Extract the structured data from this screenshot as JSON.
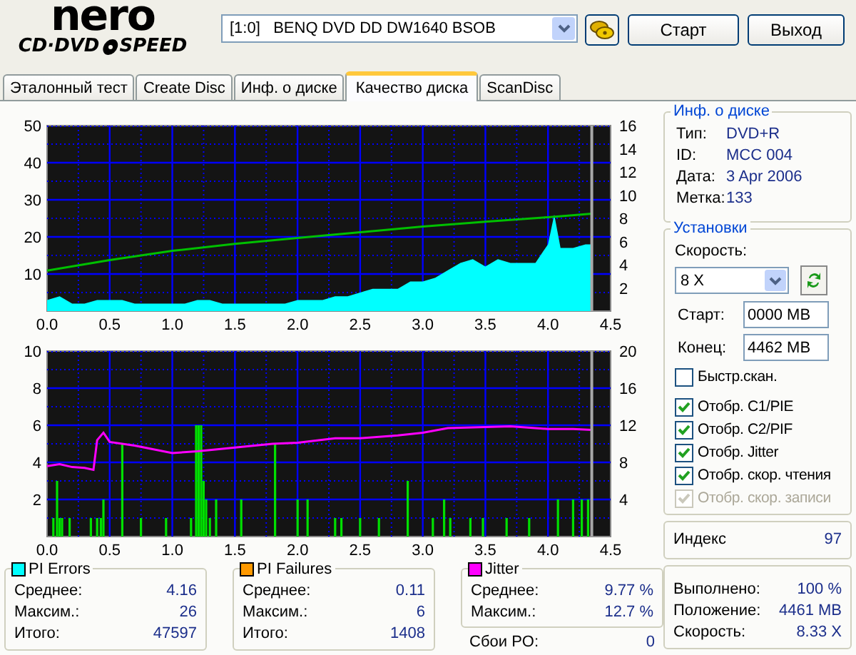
{
  "logo": {
    "brand": "nero",
    "product_left": "CD·DVD",
    "product_right": "SPEED"
  },
  "drive": {
    "value": "[1:0]   BENQ DVD DD DW1640 BSOB"
  },
  "buttons": [
    {
      "label": "Старт"
    },
    {
      "label": "Выход"
    }
  ],
  "tabs": [
    {
      "label": "Эталонный тест",
      "selected": false
    },
    {
      "label": "Create Disc",
      "selected": false
    },
    {
      "label": "Инф. о диске",
      "selected": false
    },
    {
      "label": "Качество диска",
      "selected": true
    },
    {
      "label": "ScanDisc",
      "selected": false
    }
  ],
  "charts": [
    {
      "layers": [
        {
          "chart_data": {
            "type": "area",
            "xlim": [
              0,
              4.5
            ],
            "ylim": [
              0,
              50
            ],
            "xticks": [
              {
                "value": 0,
                "label": "0.0"
              },
              {
                "value": 0.5,
                "label": "0.5"
              },
              {
                "value": 1,
                "label": "1.0"
              },
              {
                "value": 1.5,
                "label": "1.5"
              },
              {
                "value": 2,
                "label": "2.0"
              },
              {
                "value": 2.5,
                "label": "2.5"
              },
              {
                "value": 3,
                "label": "3.0"
              },
              {
                "value": 3.5,
                "label": "3.5"
              },
              {
                "value": 4,
                "label": "4.0"
              },
              {
                "value": 4.5,
                "label": "4.5"
              }
            ],
            "yticks": [
              10,
              20,
              30,
              40,
              50
            ],
            "x": [
              0,
              0.1,
              0.2,
              0.3,
              0.4,
              0.5,
              0.6,
              0.7,
              0.8,
              0.9,
              1,
              1.1,
              1.2,
              1.3,
              1.4,
              1.5,
              1.6,
              1.7,
              1.8,
              1.9,
              2,
              2.1,
              2.2,
              2.3,
              2.4,
              2.5,
              2.6,
              2.7,
              2.8,
              2.9,
              3,
              3.1,
              3.2,
              3.3,
              3.4,
              3.5,
              3.6,
              3.7,
              3.8,
              3.9,
              4,
              4.05,
              4.1,
              4.2,
              4.3,
              4.35
            ],
            "series": [
              {
                "color": "#00ffff",
                "values": [
                  3,
                  4,
                  2,
                  2,
                  3,
                  3,
                  3,
                  2,
                  2,
                  2,
                  2,
                  2,
                  3,
                  3,
                  2,
                  2,
                  2,
                  2,
                  2,
                  2,
                  3,
                  3,
                  3,
                  4,
                  4,
                  5,
                  6,
                  6,
                  6,
                  8,
                  8,
                  9,
                  11,
                  13,
                  14,
                  12,
                  14,
                  13,
                  13,
                  13,
                  18,
                  26,
                  17,
                  17,
                  18,
                  18
                ]
              }
            ]
          }
        },
        {
          "chart_data": {
            "type": "line",
            "xlim": [
              0,
              4.5
            ],
            "ylim": [
              0,
              16
            ],
            "yticks": [
              2,
              4,
              6,
              8,
              10,
              12,
              14,
              16
            ],
            "x": [
              0,
              0.5,
              1,
              1.5,
              2,
              2.5,
              3,
              3.5,
              4,
              4.35
            ],
            "series": [
              {
                "color": "#00c000",
                "values": [
                  3.5,
                  4.4,
                  5.2,
                  5.8,
                  6.3,
                  6.8,
                  7.3,
                  7.7,
                  8.1,
                  8.4
                ]
              }
            ]
          }
        }
      ]
    },
    {
      "layers": [
        {
          "chart_data": {
            "type": "bar",
            "xlim": [
              0,
              4.5
            ],
            "ylim": [
              0,
              10
            ],
            "xticks": [
              {
                "value": 0,
                "label": "0.0"
              },
              {
                "value": 0.5,
                "label": "0.5"
              },
              {
                "value": 1,
                "label": "1.0"
              },
              {
                "value": 1.5,
                "label": "1.5"
              },
              {
                "value": 2,
                "label": "2.0"
              },
              {
                "value": 2.5,
                "label": "2.5"
              },
              {
                "value": 3,
                "label": "3.0"
              },
              {
                "value": 3.5,
                "label": "3.5"
              },
              {
                "value": 4,
                "label": "4.0"
              },
              {
                "value": 4.5,
                "label": "4.5"
              }
            ],
            "yticks": [
              2,
              4,
              6,
              8,
              10
            ],
            "x": [
              0.05,
              0.08,
              0.1,
              0.12,
              0.18,
              0.35,
              0.4,
              0.43,
              0.45,
              0.6,
              0.75,
              0.95,
              1.15,
              1.19,
              1.21,
              1.23,
              1.25,
              1.27,
              1.3,
              1.35,
              1.55,
              1.82,
              2.0,
              2.08,
              2.3,
              2.35,
              2.5,
              2.65,
              2.88,
              3.08,
              3.17,
              3.22,
              3.38,
              3.48,
              3.67,
              3.85,
              4.08,
              4.2,
              4.27,
              4.32
            ],
            "series": [
              {
                "color": "#00e000",
                "values": [
                  1,
                  3,
                  1,
                  1,
                  1,
                  1,
                  1,
                  1,
                  2,
                  5,
                  1,
                  1,
                  1,
                  6,
                  6,
                  6,
                  3,
                  2,
                  1,
                  2,
                  2,
                  5,
                  2,
                  2,
                  1,
                  1,
                  1,
                  1,
                  3,
                  1,
                  2,
                  1,
                  1,
                  1,
                  1,
                  1,
                  2,
                  2,
                  2,
                  2
                ]
              }
            ]
          }
        },
        {
          "chart_data": {
            "type": "line",
            "xlim": [
              0,
              4.5
            ],
            "ylim": [
              0,
              20
            ],
            "yticks": [
              4,
              8,
              12,
              16,
              20
            ],
            "x": [
              0,
              0.1,
              0.2,
              0.3,
              0.37,
              0.4,
              0.45,
              0.5,
              0.7,
              1.0,
              1.2,
              1.5,
              1.8,
              2.0,
              2.3,
              2.5,
              2.8,
              3.0,
              3.2,
              3.5,
              3.7,
              4.0,
              4.2,
              4.35
            ],
            "series": [
              {
                "color": "#ff00ff",
                "values": [
                  7.6,
                  7.8,
                  7.5,
                  7.4,
                  7.2,
                  10.4,
                  11.2,
                  10.2,
                  9.8,
                  9.0,
                  9.2,
                  9.6,
                  10.0,
                  10.1,
                  10.6,
                  10.6,
                  10.9,
                  11.2,
                  11.7,
                  11.8,
                  11.9,
                  11.6,
                  11.6,
                  11.5
                ]
              }
            ]
          }
        }
      ]
    }
  ],
  "disc_info": {
    "title": "Инф. о диске",
    "rows": [
      {
        "label": "Тип:",
        "value": "DVD+R"
      },
      {
        "label": "ID:",
        "value": "MCC 004"
      },
      {
        "label": "Дата:",
        "value": "3 Apr 2006"
      },
      {
        "label": "Метка:",
        "value": "133"
      }
    ]
  },
  "settings": {
    "title": "Установки",
    "speed_label": "Скорость:",
    "speed": "8 X",
    "start_label": "Старт:",
    "start": "0000 MB",
    "end_label": "Конец:",
    "end": "4462 MB",
    "options": [
      {
        "label": "Быстр.скан.",
        "checked": false,
        "disabled": false
      },
      {
        "label": "Отобр. C1/PIE",
        "checked": true,
        "disabled": false
      },
      {
        "label": "Отобр. C2/PIF",
        "checked": true,
        "disabled": false
      },
      {
        "label": "Отобр. Jitter",
        "checked": true,
        "disabled": false
      },
      {
        "label": "Отобр. скор. чтения",
        "checked": true,
        "disabled": false
      },
      {
        "label": "Отобр. скор. записи",
        "checked": true,
        "disabled": true
      }
    ]
  },
  "index": {
    "label": "Индекс",
    "value": "97"
  },
  "progress": [
    {
      "label": "Выполнено:",
      "value": "100 %"
    },
    {
      "label": "Положение:",
      "value": "4461 MB"
    },
    {
      "label": "Скорость:",
      "value": "8.33 X"
    }
  ],
  "stats": [
    {
      "title": "PI Errors",
      "color": "#00ffff",
      "rows": [
        {
          "label": "Среднее:",
          "value": "4.16"
        },
        {
          "label": "Максим.:",
          "value": "26"
        },
        {
          "label": "Итого:",
          "value": "47597"
        }
      ]
    },
    {
      "title": "PI Failures",
      "color": "#ff9900",
      "rows": [
        {
          "label": "Среднее:",
          "value": "0.11"
        },
        {
          "label": "Максим.:",
          "value": "6"
        },
        {
          "label": "Итого:",
          "value": "1408"
        }
      ]
    },
    {
      "title": "Jitter",
      "color": "#ff00ff",
      "rows": [
        {
          "label": "Среднее:",
          "value": "9.77 %"
        },
        {
          "label": "Максим.:",
          "value": "12.7 %"
        }
      ]
    }
  ],
  "po_failures": {
    "label": "Сбои PO:",
    "value": "0"
  }
}
